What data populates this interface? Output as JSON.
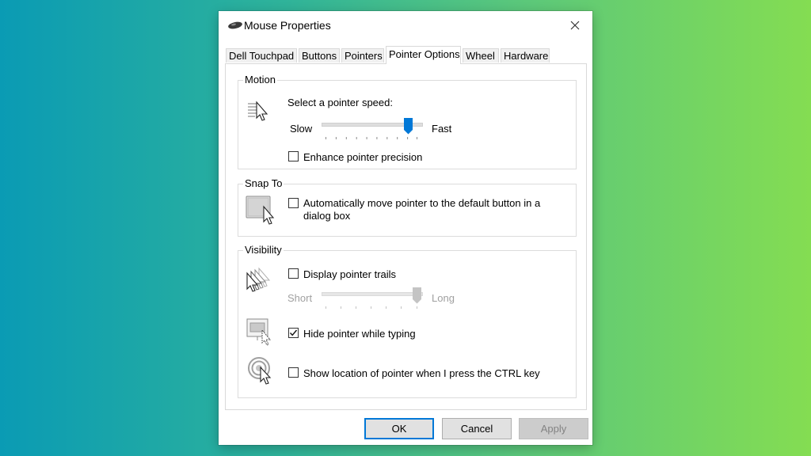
{
  "window": {
    "title": "Mouse Properties"
  },
  "tabs": [
    {
      "label": "Dell Touchpad"
    },
    {
      "label": "Buttons"
    },
    {
      "label": "Pointers"
    },
    {
      "label": "Pointer Options"
    },
    {
      "label": "Wheel"
    },
    {
      "label": "Hardware"
    }
  ],
  "active_tab": "Pointer Options",
  "motion": {
    "group_label": "Motion",
    "speed_label": "Select a pointer speed:",
    "slow_label": "Slow",
    "fast_label": "Fast",
    "speed_value": 0.9,
    "enhance_label": "Enhance pointer precision",
    "enhance_checked": false
  },
  "snap_to": {
    "group_label": "Snap To",
    "auto_move_label_line1": "Automatically move pointer to the default button in a",
    "auto_move_label_line2": "dialog box",
    "auto_move_checked": false
  },
  "visibility": {
    "group_label": "Visibility",
    "trails_label": "Display pointer trails",
    "trails_checked": false,
    "short_label": "Short",
    "long_label": "Long",
    "trails_value": 1.0,
    "hide_label": "Hide pointer while typing",
    "hide_checked": true,
    "ctrl_label": "Show location of pointer when I press the CTRL key",
    "ctrl_checked": false
  },
  "buttons": {
    "ok": "OK",
    "cancel": "Cancel",
    "apply": "Apply"
  },
  "colors": {
    "accent": "#0078d7",
    "bg_gradient_start": "#0a9bb4",
    "bg_gradient_end": "#84dd52"
  }
}
